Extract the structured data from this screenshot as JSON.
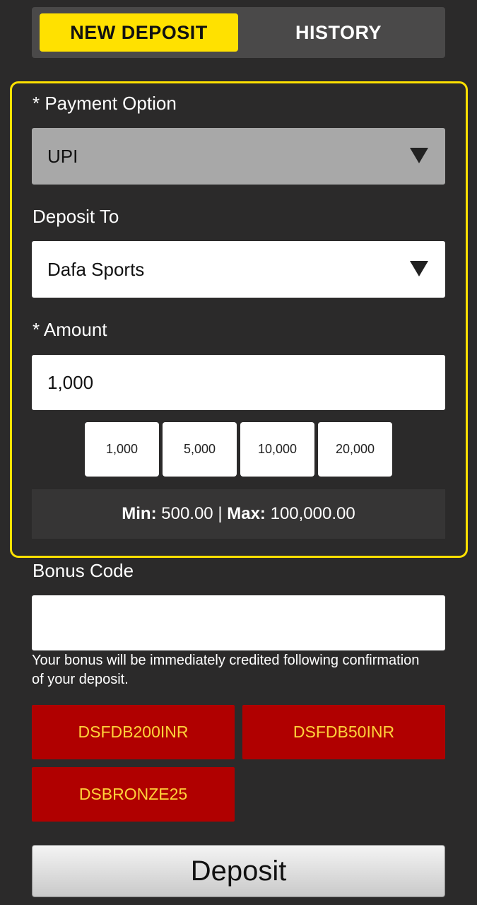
{
  "tabs": {
    "new_deposit": "NEW DEPOSIT",
    "history": "HISTORY"
  },
  "form": {
    "payment_option_label": "* Payment Option",
    "payment_option_value": "UPI",
    "deposit_to_label": "Deposit To",
    "deposit_to_value": "Dafa Sports",
    "amount_label": "* Amount",
    "amount_value": "1,000",
    "quick_amounts": [
      "1,000",
      "5,000",
      "10,000",
      "20,000"
    ],
    "limits": {
      "min_label": "Min:",
      "min_value": "500.00",
      "separator": "|",
      "max_label": "Max:",
      "max_value": "100,000.00"
    },
    "bonus_code_label": "Bonus Code",
    "bonus_code_value": "",
    "bonus_hint": "Your bonus will be immediately credited following confirmation of your deposit.",
    "bonus_codes": [
      "DSFDB200INR",
      "DSFDB50INR",
      "DSBRONZE25"
    ],
    "submit_label": "Deposit"
  },
  "colors": {
    "accent": "#ffe100",
    "bonus_bg": "#b00000",
    "bonus_text": "#ffd23a",
    "background": "#2b2a2a"
  }
}
